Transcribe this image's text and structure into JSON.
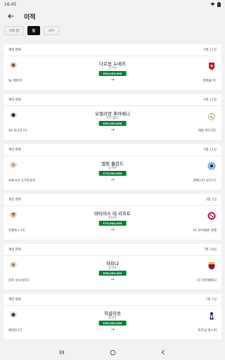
{
  "status_bar": {
    "time": "16:45"
  },
  "header": {
    "title": "이적"
  },
  "filters": [
    {
      "label": "이적 탭",
      "active": false
    },
    {
      "label": "탑",
      "active": true
    },
    {
      "label": "모두",
      "active": false
    }
  ],
  "transfers": [
    {
      "status": "계약 완료",
      "date": "6월 11일",
      "player": "다르윈 누녜즈",
      "position": "공격수",
      "fee": "€80,000,000",
      "arrow": "→",
      "from_club": "SL 벤피카",
      "to_club": "리버풀 FC",
      "to_badge": "liverpool-badge-icon",
      "from_photo": "player-photo-nunez"
    },
    {
      "status": "계약 완료",
      "date": "6월 11일",
      "player": "오렐리앙 추아메니",
      "position": "미드필더",
      "fee": "€80,000,000",
      "arrow": "→",
      "from_club": "AS 모나코 FC",
      "to_club": "레알 마드리드",
      "to_badge": "real-madrid-badge-icon",
      "from_photo": "player-photo-tchouameni"
    },
    {
      "status": "계약 완료",
      "date": "5월 11일",
      "player": "엘링 홀란드",
      "position": "공격수",
      "fee": "€75,000,000",
      "arrow": "→",
      "from_club": "보루시아 도르트문트",
      "to_club": "맨체스터 시티 FC",
      "to_badge": "manchester-city-badge-icon",
      "from_photo": "player-photo-haaland"
    },
    {
      "status": "계약 완료",
      "date": "3월 1일",
      "player": "마티아스 데 리흐트",
      "position": "수비수",
      "fee": "€70,000,000",
      "arrow": "→",
      "from_club": "유벤투스 FC",
      "to_club": "FC 바이에른 뮌헨",
      "to_badge": "bayern-badge-icon",
      "from_photo": "player-photo-de-ligt"
    },
    {
      "status": "계약 완료",
      "date": "7월 18일",
      "player": "하피냐",
      "position": "공격수",
      "fee": "€58,000,000",
      "arrow": "→",
      "from_club": "리즈 유나이티드",
      "to_club": "FC 바르셀로나",
      "to_badge": "barcelona-badge-icon",
      "from_photo": "player-photo-raphinha"
    },
    {
      "status": "계약 완료",
      "date": "7월 1일",
      "player": "히샬리송",
      "position": "공격수",
      "fee": "€58,000,000",
      "arrow": "→",
      "from_club": "에버턴 FC",
      "to_club": "토트넘 홋스퍼",
      "to_badge": "tottenham-badge-icon",
      "from_photo": "player-photo-richarlison"
    }
  ],
  "colors": {
    "accent_green": "#0a7d39",
    "active_chip": "#111111"
  }
}
